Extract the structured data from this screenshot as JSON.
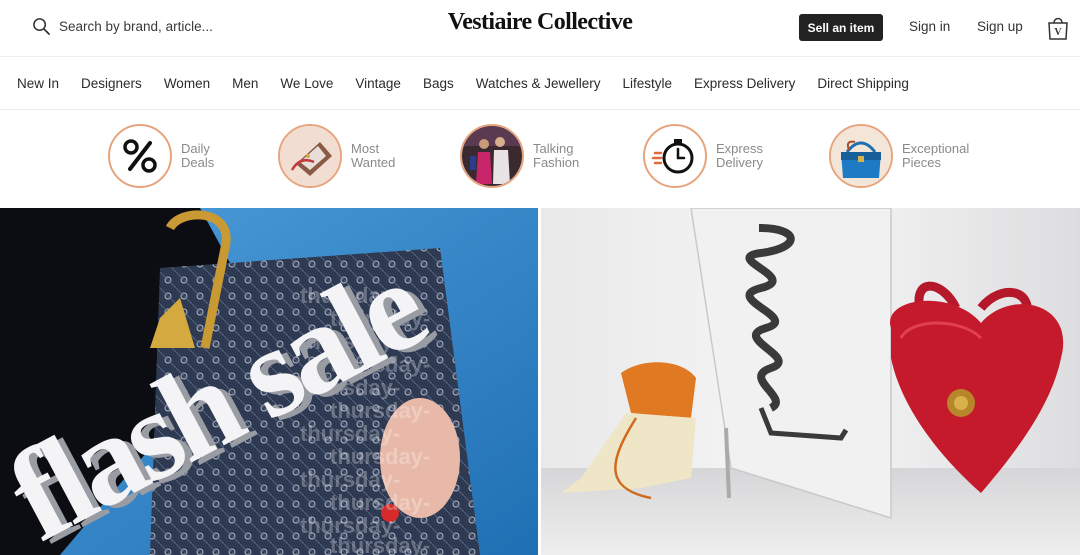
{
  "header": {
    "search_placeholder": "Search by brand, article...",
    "logo": "Vestiaire Collective",
    "sell_label": "Sell an item",
    "sign_in": "Sign in",
    "sign_up": "Sign up",
    "bag_letter": "V"
  },
  "nav": {
    "items": [
      "New In",
      "Designers",
      "Women",
      "Men",
      "We Love",
      "Vintage",
      "Bags",
      "Watches & Jewellery",
      "Lifestyle",
      "Express Delivery",
      "Direct Shipping"
    ]
  },
  "shortcuts": [
    {
      "label": "Daily\nDeals",
      "icon": "percent-icon"
    },
    {
      "label": "Most\nWanted",
      "icon": "handbag-photo"
    },
    {
      "label": "Talking\nFashion",
      "icon": "people-photo"
    },
    {
      "label": "Express\nDelivery",
      "icon": "stopwatch-icon"
    },
    {
      "label": "Exceptional\nPieces",
      "icon": "birkin-photo"
    }
  ],
  "banners": {
    "left_title": "flash sale",
    "left_repeat_text": "thursday-"
  },
  "colors": {
    "accent_ring": "#e6a57e",
    "button_dark": "#222222"
  }
}
